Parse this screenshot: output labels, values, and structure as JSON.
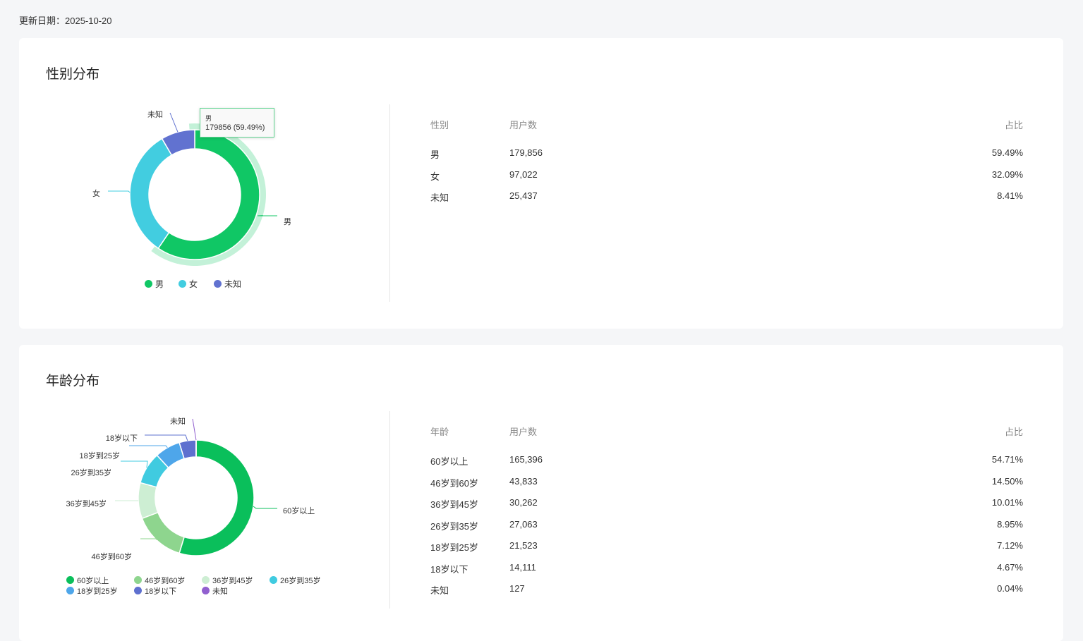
{
  "update_label": "更新日期：",
  "update_date": "2025-10-20",
  "gender": {
    "title": "性别分布",
    "headers": [
      "性别",
      "用户数",
      "占比"
    ],
    "rows": [
      [
        "男",
        "179,856",
        "59.49%"
      ],
      [
        "女",
        "97,022",
        "32.09%"
      ],
      [
        "未知",
        "25,437",
        "8.41%"
      ]
    ],
    "tooltip": {
      "name": "男",
      "value": "179856 (59.49%)"
    }
  },
  "age": {
    "title": "年龄分布",
    "headers": [
      "年龄",
      "用户数",
      "占比"
    ],
    "rows": [
      [
        "60岁以上",
        "165,396",
        "54.71%"
      ],
      [
        "46岁到60岁",
        "43,833",
        "14.50%"
      ],
      [
        "36岁到45岁",
        "30,262",
        "10.01%"
      ],
      [
        "26岁到35岁",
        "27,063",
        "8.95%"
      ],
      [
        "18岁到25岁",
        "21,523",
        "7.12%"
      ],
      [
        "18岁以下",
        "14,111",
        "4.67%"
      ],
      [
        "未知",
        "127",
        "0.04%"
      ]
    ]
  },
  "chart_data": [
    {
      "type": "pie",
      "title": "性别分布",
      "categories": [
        "男",
        "女",
        "未知"
      ],
      "values": [
        179856,
        97022,
        25437
      ],
      "colors": [
        "#10c765",
        "#42cde0",
        "#6172d0"
      ],
      "highlighted": "男",
      "legend": "bottom"
    },
    {
      "type": "pie",
      "title": "年龄分布",
      "categories": [
        "60岁以上",
        "46岁到60岁",
        "36岁到45岁",
        "26岁到35岁",
        "18岁到25岁",
        "18岁以下",
        "未知"
      ],
      "values": [
        165396,
        43833,
        30262,
        27063,
        21523,
        14111,
        127
      ],
      "colors": [
        "#0abf5b",
        "#8ed58e",
        "#cdeed3",
        "#40cbe0",
        "#4ea6ea",
        "#5e70cf",
        "#9160cf"
      ],
      "legend": "bottom"
    }
  ]
}
